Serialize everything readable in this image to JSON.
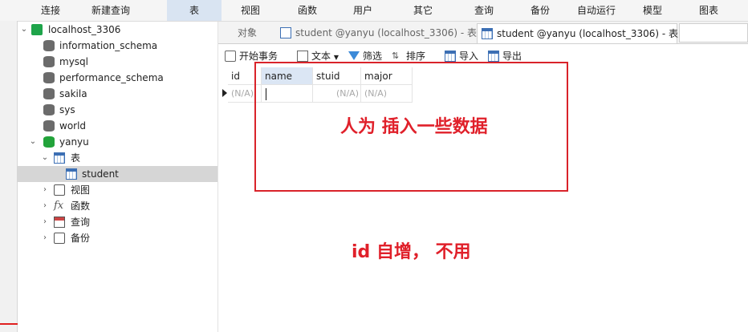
{
  "menu": {
    "items": [
      "连接",
      "新建查询",
      "表",
      "视图",
      "函数",
      "用户",
      "其它",
      "查询",
      "备份",
      "自动运行",
      "模型",
      "图表"
    ],
    "active_index": 2
  },
  "tree": {
    "connection": "localhost_3306",
    "databases": [
      "information_schema",
      "mysql",
      "performance_schema",
      "sakila",
      "sys",
      "world",
      "yanyu"
    ],
    "groups": {
      "tables": "表",
      "table_selected": "student",
      "views": "视图",
      "functions": "函数",
      "queries": "查询",
      "backups": "备份"
    },
    "function_glyph": "fx"
  },
  "tabs": {
    "objects": "对象",
    "design_tab": "student @yanyu (localhost_3306) - 表",
    "data_tab": "student @yanyu (localhost_3306) - 表"
  },
  "toolbar": {
    "begin_transaction": "开始事务",
    "text": "文本",
    "filter": "筛选",
    "sort": "排序",
    "import": "导入",
    "export": "导出"
  },
  "grid": {
    "columns": [
      "id",
      "name",
      "stuid",
      "major"
    ],
    "selected_column": "name",
    "rows": [
      {
        "id": "(N/A)",
        "name": "",
        "stuid": "(N/A)",
        "major": "(N/A)"
      }
    ]
  },
  "annotations": {
    "manual_insert": "人为  插入一些数据",
    "id_note": "id  自增， 不用"
  },
  "colors": {
    "annotation_red": "#e0202a",
    "active_menu": "#d9e4f2",
    "selected_row": "#d6d6d6"
  }
}
